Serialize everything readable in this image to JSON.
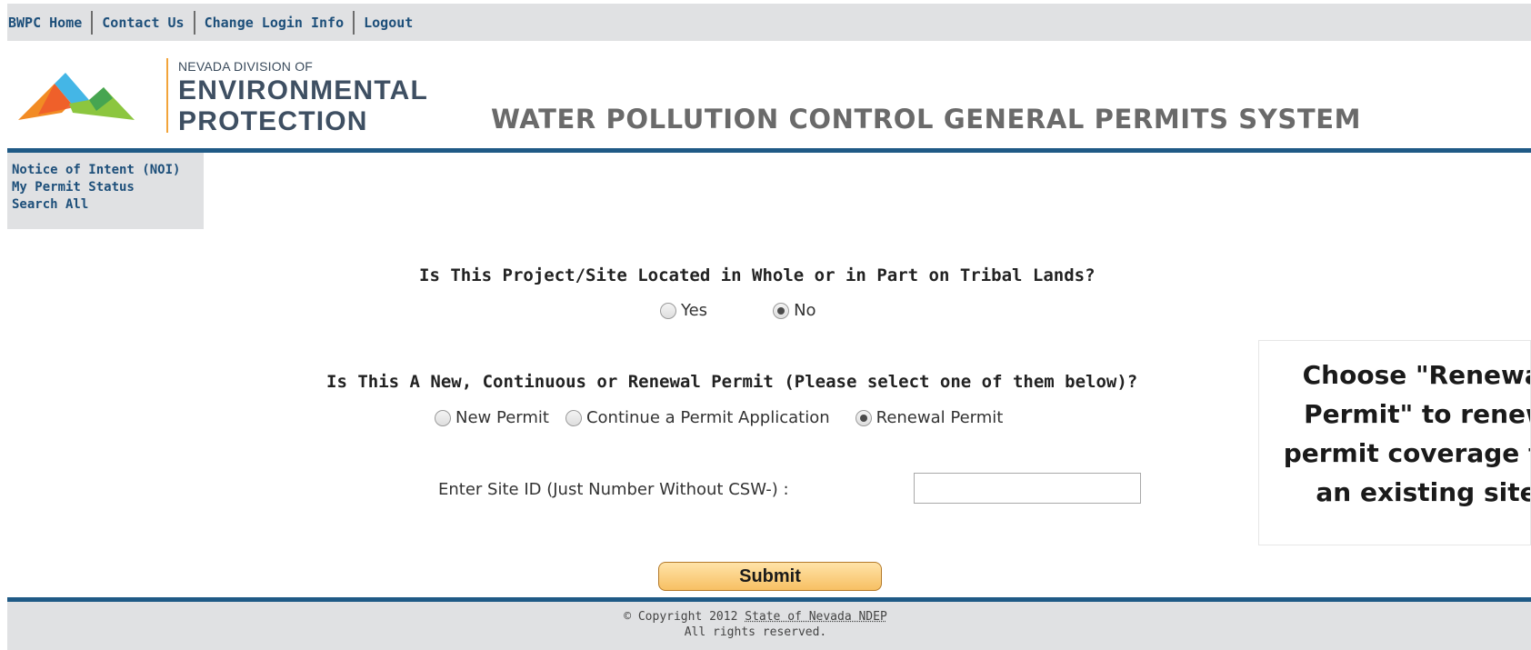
{
  "topnav": {
    "items": [
      "BWPC Home",
      "Contact Us",
      "Change Login Info",
      "Logout"
    ]
  },
  "header": {
    "logo_small": "NEVADA DIVISION OF",
    "logo_line1": "ENVIRONMENTAL",
    "logo_line2": "PROTECTION",
    "system_title": "WATER POLLUTION CONTROL GENERAL PERMITS SYSTEM"
  },
  "sidemenu": {
    "items": [
      "Notice of Intent (NOI)",
      "My Permit Status",
      "Search All"
    ]
  },
  "form": {
    "tribal_question": "Is This Project/Site Located in Whole or in Part on Tribal Lands?",
    "tribal_options": [
      "Yes",
      "No"
    ],
    "tribal_selected": "No",
    "permit_question": "Is This A New, Continuous or Renewal Permit (Please select one of them below)?",
    "permit_options": [
      "New Permit",
      "Continue a Permit Application",
      "Renewal Permit"
    ],
    "permit_selected": "Renewal Permit",
    "site_id_label": "Enter Site ID (Just Number Without CSW-) :",
    "site_id_value": "",
    "submit_label": "Submit"
  },
  "footer": {
    "copyright_prefix": "© Copyright 2012 ",
    "copyright_link": "State of Nevada NDEP",
    "rights": "All rights reserved."
  },
  "callout": {
    "text": "Choose \"Renewal\nPermit\" to renew\npermit coverage for\nan existing site"
  },
  "colors": {
    "accent_blue": "#1f5a86",
    "link_blue": "#1d4f7a",
    "nav_gray": "#e0e1e3",
    "button_orange": "#f7c063",
    "logo_divider": "#f2a43a"
  }
}
